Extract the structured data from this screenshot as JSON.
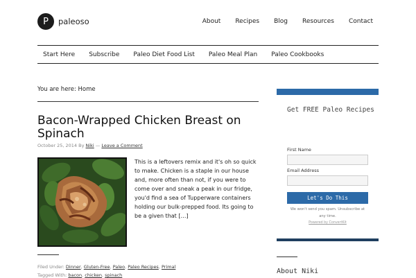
{
  "site": {
    "logo_letter": "P",
    "name": "paleoso"
  },
  "top_nav": [
    "About",
    "Recipes",
    "Blog",
    "Resources",
    "Contact"
  ],
  "sub_nav": [
    "Start Here",
    "Subscribe",
    "Paleo Diet Food List",
    "Paleo Meal Plan",
    "Paleo Cookbooks"
  ],
  "breadcrumb": {
    "prefix": "You are here:",
    "current": "Home"
  },
  "post": {
    "title": "Bacon-Wrapped Chicken Breast on Spinach",
    "date": "October 25, 2014",
    "by": "By",
    "author": "Niki",
    "separator": "—",
    "comment_link": "Leave a Comment",
    "excerpt": "This is a leftovers remix and it's oh so quick to make. Chicken is a staple in our house and, more often than not, if you were to come over and sneak a peak in our fridge, you'd find a sea of Tupperware containers holding our bulk-prepped food. Its going to be a given that […]",
    "filed_label": "Filed Under:",
    "categories": [
      "Dinner",
      "Gluten-Free",
      "Paleo",
      "Paleo Recipes",
      "Primal"
    ],
    "tagged_label": "Tagged With:",
    "tags": [
      "bacon",
      "chicken",
      "spinach"
    ]
  },
  "signup_widget": {
    "title": "Get FREE Paleo Recipes",
    "first_name_label": "First Name",
    "email_label": "Email Address",
    "button_label": "Let's Do This",
    "note": "We won't send you spam. Unsubscribe at any time.",
    "powered": "Powered by ConvertKit",
    "accent_color": "#2c6aa8"
  },
  "about_widget": {
    "title": "About Niki"
  }
}
